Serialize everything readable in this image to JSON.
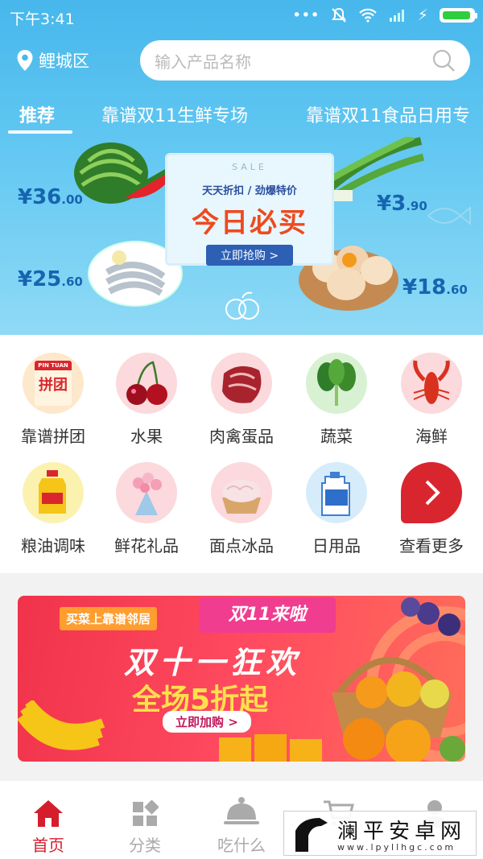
{
  "status_bar": {
    "time": "下午3:41"
  },
  "header": {
    "location": "鲤城区",
    "search_placeholder": "输入产品名称"
  },
  "tabs": [
    {
      "label": "推荐",
      "active": true
    },
    {
      "label": "靠谱双11生鲜专场",
      "active": false
    },
    {
      "label": "靠谱双11食品日用专",
      "active": false
    }
  ],
  "banner": {
    "sale_word": "SALE",
    "subtitle": "天天折扣 / 劲爆特价",
    "headline": "今日必买",
    "cta": "立即抢购 >",
    "prices": [
      {
        "big": "¥36",
        "small": ".00"
      },
      {
        "big": "¥3",
        "small": ".90"
      },
      {
        "big": "¥25",
        "small": ".60"
      },
      {
        "big": "¥18",
        "small": ".60"
      }
    ]
  },
  "categories": [
    {
      "label": "靠谱拼团",
      "icon": "group-buy-icon",
      "icon_text_top": "PIN TUAN",
      "icon_text": "拼团"
    },
    {
      "label": "水果",
      "icon": "cherry-icon"
    },
    {
      "label": "肉禽蛋品",
      "icon": "meat-icon"
    },
    {
      "label": "蔬菜",
      "icon": "vegetable-icon"
    },
    {
      "label": "海鲜",
      "icon": "lobster-icon"
    },
    {
      "label": "粮油调味",
      "icon": "oil-icon"
    },
    {
      "label": "鲜花礼品",
      "icon": "flower-icon"
    },
    {
      "label": "面点冰品",
      "icon": "dumpling-icon"
    },
    {
      "label": "日用品",
      "icon": "detergent-icon"
    },
    {
      "label": "查看更多",
      "icon": "chevron-right-icon"
    }
  ],
  "promo": {
    "tagline": "买菜上靠谱邻居",
    "badge": "双11来啦",
    "title": "双十一狂欢",
    "subtitle": "全场5折起",
    "cta": "立即加购 >"
  },
  "tabbar": [
    {
      "label": "首页",
      "icon": "home-icon",
      "active": true
    },
    {
      "label": "分类",
      "icon": "category-grid-icon",
      "active": false
    },
    {
      "label": "吃什么",
      "icon": "food-cloche-icon",
      "active": false
    },
    {
      "label": "",
      "icon": "cart-icon",
      "active": false
    },
    {
      "label": "",
      "icon": "user-icon",
      "active": false
    }
  ],
  "watermark": {
    "name": "澜平安卓网",
    "url": "www.lpyllhgc.com"
  },
  "colors": {
    "accent": "#d51d2c",
    "hero_blue": "#47b7ec",
    "promo_red": "#f0334b"
  }
}
